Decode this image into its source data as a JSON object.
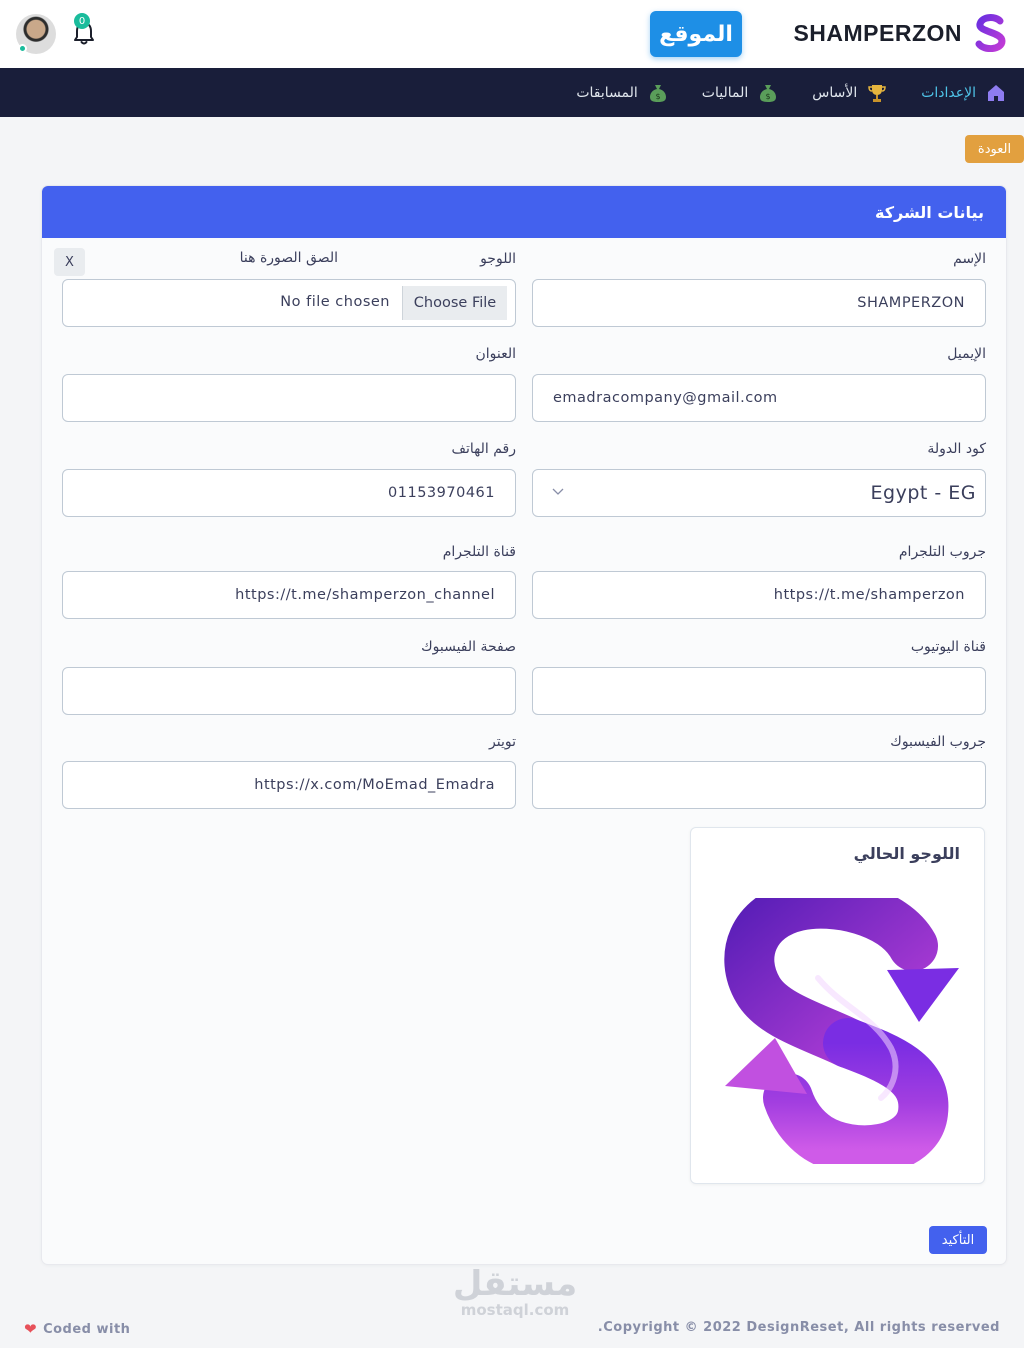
{
  "header": {
    "brand_name": "SHAMPERZON",
    "site_button": "الموقع",
    "notification_count": "0"
  },
  "nav": {
    "items": [
      {
        "label": "الإعدادات",
        "icon": "home-icon",
        "active": true
      },
      {
        "label": "الأساس",
        "icon": "trophy-icon",
        "active": false
      },
      {
        "label": "الماليات",
        "icon": "money-bag-icon",
        "active": false
      },
      {
        "label": "المسابقات",
        "icon": "money-bag-icon",
        "active": false
      }
    ]
  },
  "back_button": "العودة",
  "card": {
    "title": "بيانات الشركة",
    "fields": {
      "name": {
        "label": "الإسم",
        "value": "SHAMPERZON"
      },
      "logo": {
        "label": "اللوجو",
        "paste_label": "الصق الصورة هنا",
        "button": "Choose File",
        "status": "No file chosen",
        "clear": "X"
      },
      "email": {
        "label": "الإيميل",
        "value": "emadracompany@gmail.com"
      },
      "address": {
        "label": "العنوان",
        "value": ""
      },
      "country_code": {
        "label": "كود الدولة",
        "value": "Egypt - EG"
      },
      "phone": {
        "label": "رقم الهاتف",
        "value": "01153970461"
      },
      "telegram_group": {
        "label": "جروب التلجرام",
        "value": "https://t.me/shamperzon"
      },
      "telegram_channel": {
        "label": "قناة التلجرام",
        "value": "https://t.me/shamperzon_channel"
      },
      "youtube": {
        "label": "قناة اليوتيوب",
        "value": ""
      },
      "facebook_page": {
        "label": "صفحة الفيسبوك",
        "value": ""
      },
      "facebook_group": {
        "label": "جروب الفيسبوك",
        "value": ""
      },
      "twitter": {
        "label": "تويتر",
        "value": "https://x.com/MoEmad_Emadra"
      }
    },
    "current_logo_title": "اللوجو الحالي",
    "confirm_button": "التأكيد"
  },
  "watermark": {
    "arabic": "مستقل",
    "latin": "mostaql.com"
  },
  "footer": {
    "left": "Coded with",
    "right": ".Copyright © 2022 DesignReset, All rights reserved"
  },
  "colors": {
    "primary": "#4361ee",
    "navbar": "#191e3a",
    "warning": "#e2a03f",
    "site_button": "#1e8fe6",
    "brand_purple": "#8b2be2"
  }
}
